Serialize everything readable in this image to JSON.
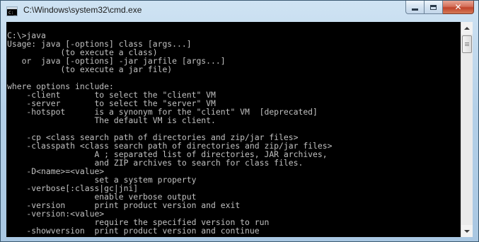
{
  "window": {
    "title": "C:\\Windows\\system32\\cmd.exe",
    "icon": "cmd-console-icon"
  },
  "controls": {
    "minimize_icon": "minimize-icon",
    "maximize_icon": "maximize-icon",
    "close_icon": "close-icon",
    "close_glyph": "✕"
  },
  "colors": {
    "console_background": "#000000",
    "console_text": "#c0c0c0",
    "close_button": "#c0432a"
  },
  "console": {
    "lines": [
      "C:\\>java",
      "Usage: java [-options] class [args...]",
      "           (to execute a class)",
      "   or  java [-options] -jar jarfile [args...]",
      "           (to execute a jar file)",
      "",
      "where options include:",
      "    -client       to select the \"client\" VM",
      "    -server       to select the \"server\" VM",
      "    -hotspot      is a synonym for the \"client\" VM  [deprecated]",
      "                  The default VM is client.",
      "",
      "    -cp <class search path of directories and zip/jar files>",
      "    -classpath <class search path of directories and zip/jar files>",
      "                  A ; separated list of directories, JAR archives,",
      "                  and ZIP archives to search for class files.",
      "    -D<name>=<value>",
      "                  set a system property",
      "    -verbose[:class|gc|jni]",
      "                  enable verbose output",
      "    -version      print product version and exit",
      "    -version:<value>",
      "                  require the specified version to run",
      "    -showversion  print product version and continue"
    ]
  }
}
